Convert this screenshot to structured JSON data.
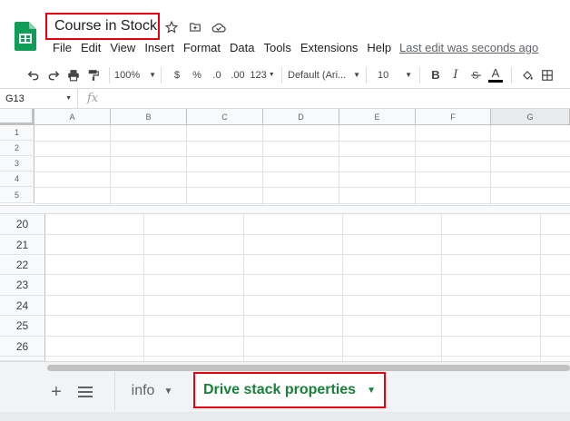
{
  "app": {
    "doc_title": "Course in Stock",
    "last_edit": "Last edit was seconds ago",
    "brand_color": "#0f9d58",
    "highlight_color": "#e8000f",
    "active_tab_color": "#188038"
  },
  "menu": [
    "File",
    "Edit",
    "View",
    "Insert",
    "Format",
    "Data",
    "Tools",
    "Extensions",
    "Help"
  ],
  "toolbar": {
    "zoom": "100%",
    "currency": "$",
    "percent": "%",
    "decrease_decimal": ".0",
    "increase_decimal": ".00",
    "more_formats": "123",
    "font": "Default (Ari...",
    "font_size": "10",
    "bold": "B",
    "italic": "I",
    "text_color": "A"
  },
  "formula_bar": {
    "cell_ref": "G13",
    "fx": "fx"
  },
  "columns": [
    "A",
    "B",
    "C",
    "D",
    "E",
    "F",
    "G"
  ],
  "rows_top": [
    "1",
    "2",
    "3",
    "4",
    "5"
  ],
  "rows_zoom": [
    "20",
    "21",
    "22",
    "23",
    "24",
    "25",
    "26"
  ],
  "sheet_tabs": {
    "add": "+",
    "tabs": [
      "info",
      "Drive stack properties"
    ],
    "active": "Drive stack properties"
  }
}
